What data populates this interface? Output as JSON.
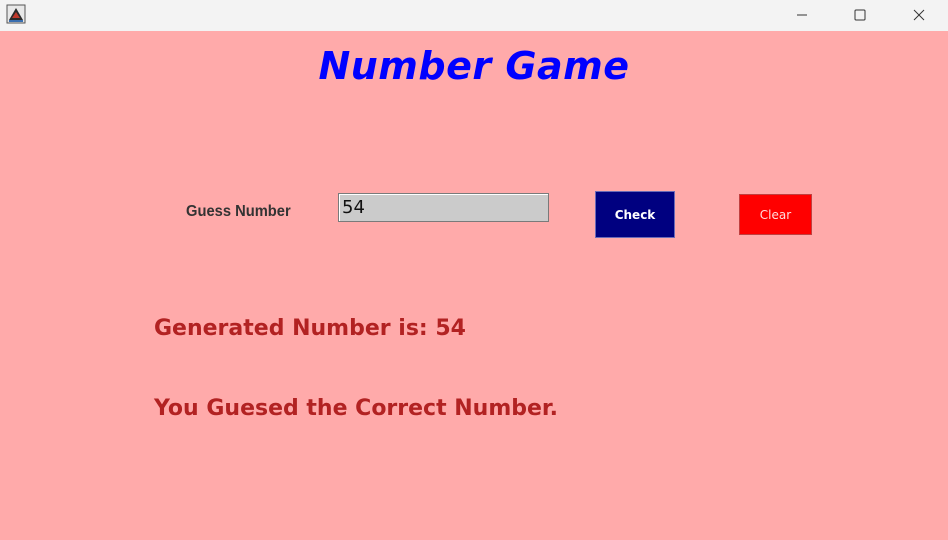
{
  "window": {
    "controls": {
      "minimize_icon": "minimize-icon",
      "maximize_icon": "maximize-icon",
      "close_icon": "close-icon"
    },
    "app_icon": "java-app-icon"
  },
  "colors": {
    "background": "#ffaaaa",
    "title": "#0000ff",
    "check_button": "#000080",
    "clear_button": "#ff0000",
    "result_text": "#b22222"
  },
  "game": {
    "title": "Number Game",
    "guess_label": "Guess Number",
    "guess_value": "54",
    "check_label": "Check",
    "clear_label": "Clear",
    "generated_text": "Generated Number is: 54",
    "result_message": "You Guesed the Correct Number."
  }
}
